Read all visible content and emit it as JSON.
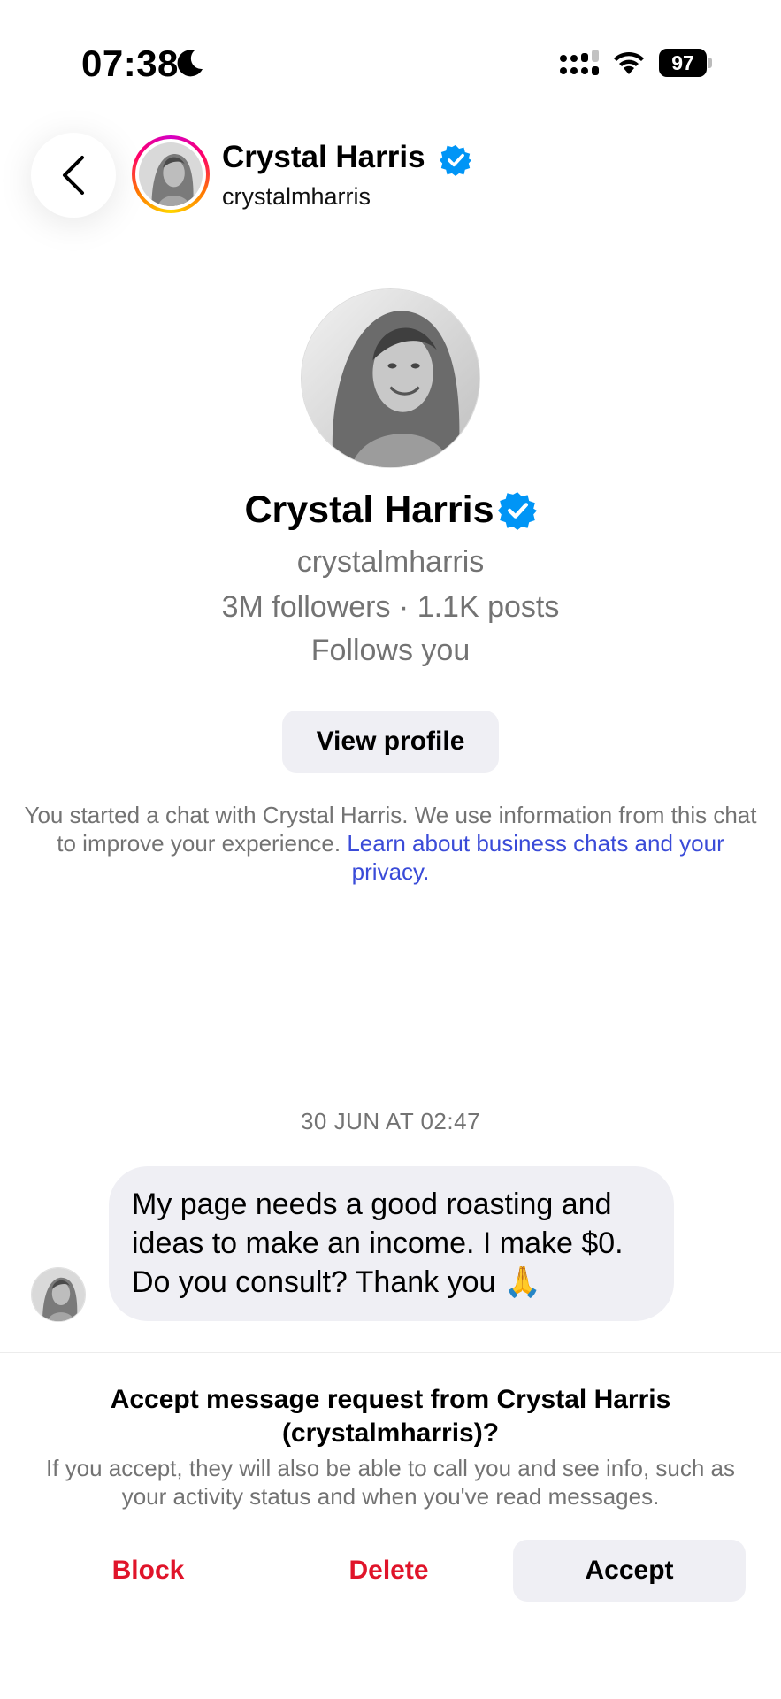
{
  "status_bar": {
    "time": "07:38",
    "battery": "97"
  },
  "header": {
    "name": "Crystal Harris",
    "username": "crystalmharris"
  },
  "profile": {
    "name": "Crystal Harris",
    "username": "crystalmharris",
    "stats": "3M followers · 1.1K posts",
    "follow_status": "Follows you",
    "view_profile_label": "View profile"
  },
  "disclaimer": {
    "text": "You started a chat with Crystal Harris. We use information from this chat to improve your experience.",
    "link": "Learn about business chats and your privacy."
  },
  "chat": {
    "timestamp": "30 JUN AT 02:47",
    "message": "My page needs a good roasting and ideas to make an income. I make $0. Do you consult? Thank you 🙏"
  },
  "request": {
    "title": "Accept message request from Crystal Harris (crystalmharris)?",
    "description": "If you accept, they will also be able to call you and see info, such as your activity status and when you've read messages.",
    "block_label": "Block",
    "delete_label": "Delete",
    "accept_label": "Accept"
  },
  "colors": {
    "verified_blue": "#0095f6",
    "link_blue": "#3a4bd8",
    "danger_red": "#e0142a",
    "button_bg": "#efeff4"
  }
}
